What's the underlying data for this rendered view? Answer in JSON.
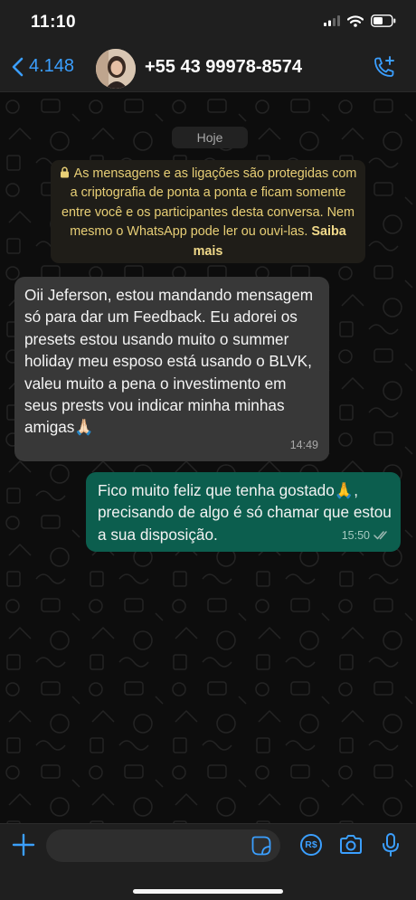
{
  "status_bar": {
    "time": "11:10",
    "icons": [
      "signal-icon",
      "wifi-icon",
      "battery-icon"
    ]
  },
  "header": {
    "back_count": "4.148",
    "contact_name": "+55 43 99978-8574",
    "accent": "#3b9fff"
  },
  "chat": {
    "date_label": "Hoje",
    "encryption_notice": "As mensagens e as ligações são protegidas com a criptografia de ponta a ponta e ficam somente entre você e os participantes desta conversa. Nem mesmo o WhatsApp pode ler ou ouvi-las.",
    "encryption_link": "Saiba mais",
    "messages": [
      {
        "direction": "incoming",
        "text": "Oii Jeferson, estou mandando mensagem só para dar um Feedback. Eu adorei os presets estou usando muito o summer holiday meu esposo está usando o BLVK, valeu muito a pena o investimento em seus prests vou indicar minha minhas amigas🙏🏻",
        "time": "14:49"
      },
      {
        "direction": "outgoing",
        "text": "Fico muito feliz que tenha gostado🙏, precisando de algo é só chamar que estou a sua disposição.",
        "time": "15:50",
        "status": "read"
      }
    ]
  },
  "composer": {
    "icons": [
      "plus-icon",
      "sticker-icon",
      "payment-icon",
      "camera-icon",
      "microphone-icon"
    ],
    "payment_badge": "R$"
  },
  "colors": {
    "incoming_bubble": "#383838",
    "outgoing_bubble": "#0c5e4e",
    "notice_text": "#e8cf76"
  }
}
